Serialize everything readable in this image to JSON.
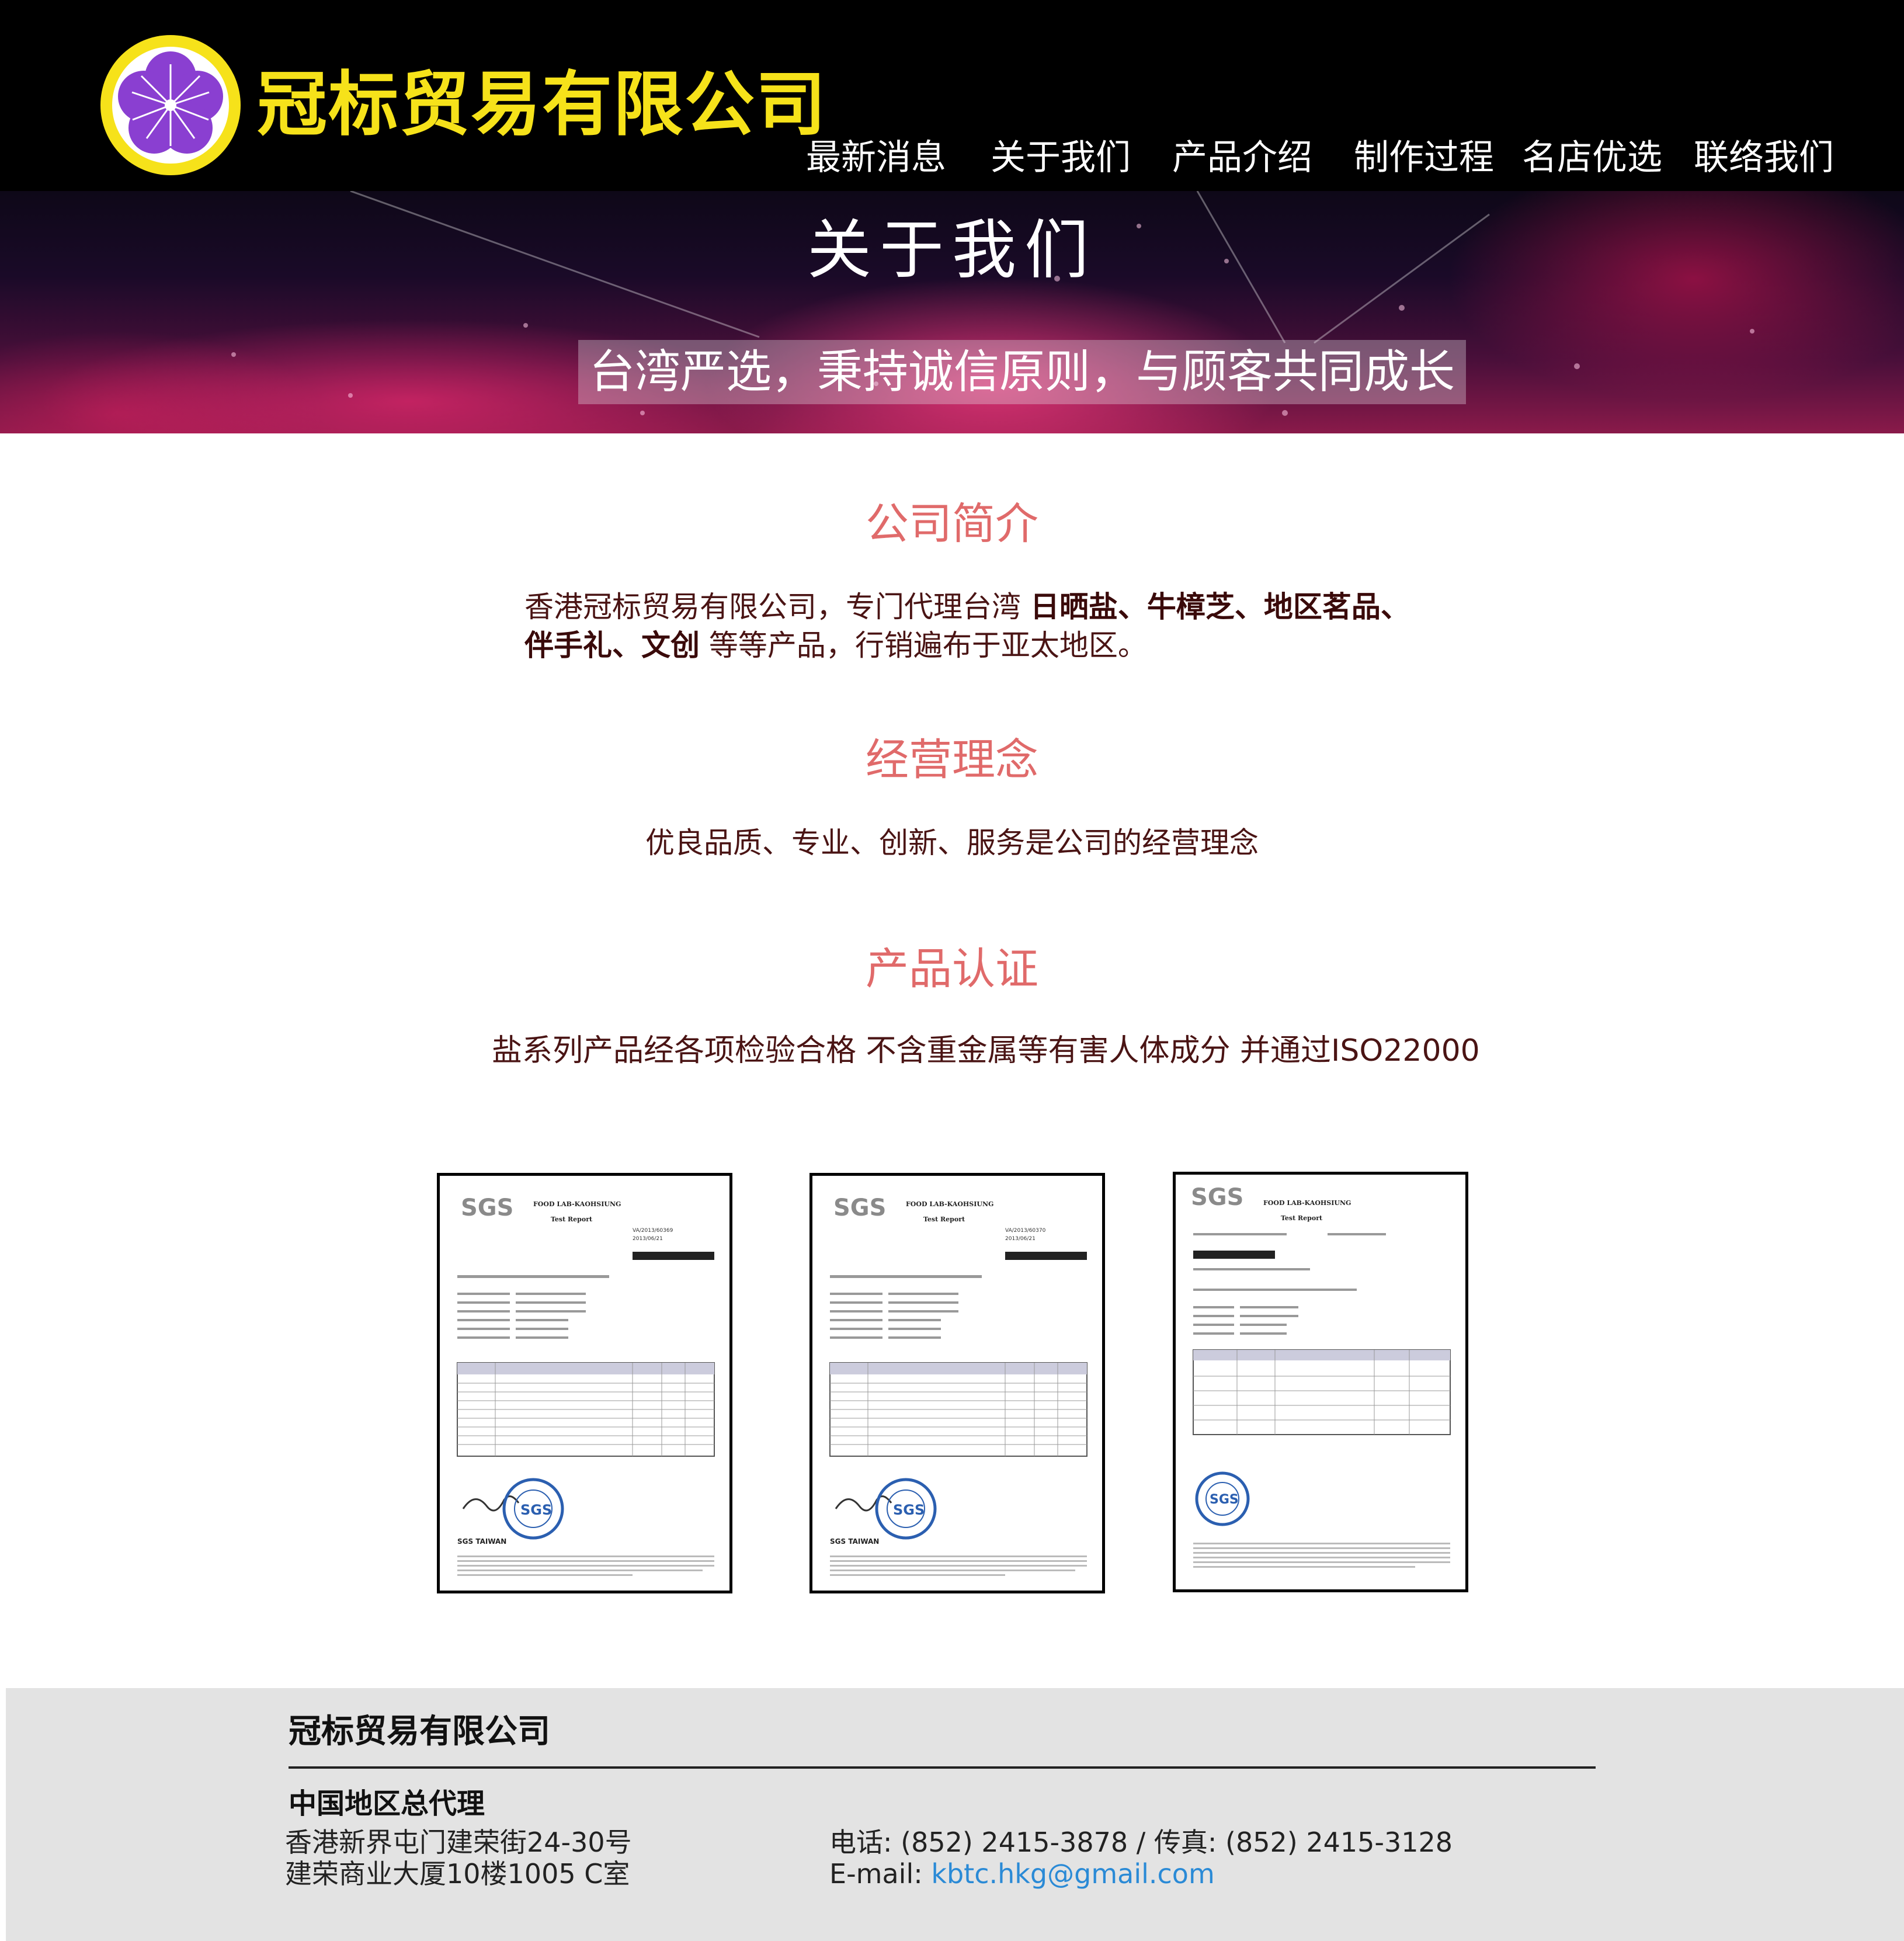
{
  "header": {
    "company_name": "冠标贸易有限公司",
    "logo_icon": "purple-flower-icon",
    "brand_colors": {
      "yellow": "#f6e21a",
      "purple": "#8a3fd1"
    },
    "nav": [
      "最新消息",
      "关于我们",
      "产品介绍",
      "制作过程",
      "名店优选",
      "联络我们"
    ]
  },
  "banner": {
    "title": "关于我们",
    "subtitle": "台湾严选，秉持诚信原则，与顾客共同成长"
  },
  "intro": {
    "title": "公司简介",
    "line1_a": "香港冠标贸易有限公司，专门代理台湾 ",
    "line1_b": "日晒盐、牛樟芝、地区茗品、",
    "line2_a": "伴手礼、文创",
    "line2_b": " 等等产品，行销遍布于亚太地区。"
  },
  "philosophy": {
    "title": "经营理念",
    "text": "优良品质、专业、创新、服务是公司的经营理念"
  },
  "certification": {
    "title": "产品认证",
    "text": "盐系列产品经各项检验合格 不含重金属等有害人体成分 并通过ISO22000",
    "certificates": [
      {
        "logo": "SGS",
        "heading": "FOOD LAB-KAOHSIUNG",
        "subheading": "Test Report",
        "report_no": "VA/2013/60369",
        "date": "2013/06/21",
        "stamp": "SGS TAIWAN"
      },
      {
        "logo": "SGS",
        "heading": "FOOD LAB-KAOHSIUNG",
        "subheading": "Test Report",
        "report_no": "VA/2013/60370",
        "date": "2013/06/21",
        "stamp": "SGS TAIWAN"
      },
      {
        "logo": "SGS",
        "heading": "FOOD LAB-KAOHSIUNG",
        "subheading": "Test Report",
        "report_no": "",
        "date": "",
        "stamp": "SGS"
      }
    ]
  },
  "footer": {
    "company": "冠标贸易有限公司",
    "agent": "中国地区总代理",
    "address1": "香港新界屯门建荣街24-30号",
    "address2": "建荣商业大厦10楼1005 C室",
    "phone": "电话: (852) 2415-3878 / 传真: (852) 2415-3128",
    "email_label": "E-mail: ",
    "email": "kbtc.hkg@gmail.com"
  }
}
